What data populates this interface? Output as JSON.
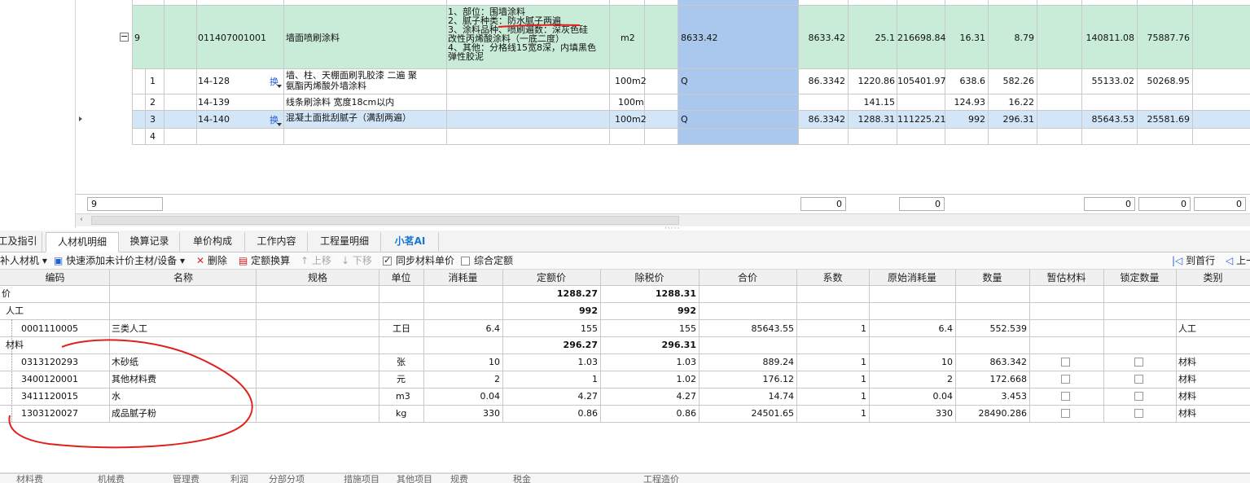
{
  "upper_grid": {
    "row9": {
      "seq": "9",
      "code": "011407001001",
      "name": "墙面喷刷涂料",
      "features": [
        "1、部位：围墙涂料",
        "2、腻子种类：防水腻子两遍",
        "3、涂料品种、喷刷遍数：深灰色硅",
        "改性丙烯酸涂料（一底二度）",
        "4、其他：分格线15宽8深，内填黑色",
        "弹性胶泥"
      ],
      "unit": "m2",
      "qty_expr": "8633.42",
      "qty": "8633.42",
      "unit_price": "25.1",
      "total": "216698.84",
      "labor": "16.31",
      "material": "8.79",
      "c1": "140811.08",
      "c2": "75887.76"
    },
    "sub_rows": [
      {
        "idx": "1",
        "code": "14-128",
        "huan": "换",
        "name_l1": "墙、柱、天棚面刷乳胶漆 二遍 聚",
        "name_l2": "氨酯丙烯酸外墙涂料",
        "unit": "100m2",
        "qty_expr": "Q",
        "qty": "86.3342",
        "unit_price": "1220.86",
        "total": "105401.97",
        "labor": "638.6",
        "material": "582.26",
        "c1": "55133.02",
        "c2": "50268.95"
      },
      {
        "idx": "2",
        "code": "14-139",
        "huan": "",
        "name_l1": "线条刷涂料 宽度18cm以内",
        "name_l2": "",
        "unit": "100m",
        "qty_expr": "",
        "qty": "",
        "unit_price": "141.15",
        "total": "",
        "labor": "124.93",
        "material": "16.22",
        "c1": "",
        "c2": ""
      },
      {
        "idx": "3",
        "code": "14-140",
        "huan": "换",
        "name_l1": "混凝土面批刮腻子（满刮两遍）",
        "name_l2": "",
        "unit": "100m2",
        "qty_expr": "Q",
        "qty": "86.3342",
        "unit_price": "1288.31",
        "total": "111225.21",
        "labor": "992",
        "material": "296.31",
        "c1": "85643.53",
        "c2": "25581.69"
      },
      {
        "idx": "4",
        "code": "",
        "huan": "",
        "name_l1": "",
        "name_l2": "",
        "unit": "",
        "qty_expr": "",
        "qty": "",
        "unit_price": "",
        "total": "",
        "labor": "",
        "material": "",
        "c1": "",
        "c2": ""
      }
    ],
    "footer": {
      "count": "9",
      "z1": "0",
      "z2": "0",
      "z3": "0",
      "z4": "0",
      "z5": "0"
    }
  },
  "tabs": [
    {
      "label": "工及指引"
    },
    {
      "label": "人材机明细"
    },
    {
      "label": "换算记录"
    },
    {
      "label": "单价构成"
    },
    {
      "label": "工作内容"
    },
    {
      "label": "工程量明细"
    },
    {
      "label": "小茗AI"
    }
  ],
  "toolbar": {
    "add_rcj": "补人材机",
    "quick_add": "快速添加未计价主材/设备",
    "delete": "删除",
    "quota_convert": "定额换算",
    "move_up": "上移",
    "move_down": "下移",
    "sync_price": "同步材料单价",
    "combined_quota": "综合定额",
    "to_first": "到首行",
    "prev": "上一"
  },
  "lower_grid": {
    "headers": [
      "编码",
      "名称",
      "规格",
      "单位",
      "消耗量",
      "定额价",
      "除税价",
      "合价",
      "系数",
      "原始消耗量",
      "数量",
      "暂估材料",
      "锁定数量",
      "类别"
    ],
    "rows": [
      {
        "code": "价",
        "name": "",
        "spec": "",
        "unit": "",
        "consume": "",
        "quota_price": "1288.27",
        "tax_ex_price": "1288.31",
        "amount": "",
        "coef": "",
        "orig": "",
        "qty": "",
        "bold": true,
        "type": ""
      },
      {
        "code": "人工",
        "name": "",
        "spec": "",
        "unit": "",
        "consume": "",
        "quota_price": "992",
        "tax_ex_price": "992",
        "amount": "",
        "coef": "",
        "orig": "",
        "qty": "",
        "bold": true,
        "type": ""
      },
      {
        "code": "0001110005",
        "name": "三类人工",
        "spec": "",
        "unit": "工日",
        "consume": "6.4",
        "quota_price": "155",
        "tax_ex_price": "155",
        "amount": "85643.55",
        "coef": "1",
        "orig": "6.4",
        "qty": "552.539",
        "bold": false,
        "type": "人工"
      },
      {
        "code": "材料",
        "name": "",
        "spec": "",
        "unit": "",
        "consume": "",
        "quota_price": "296.27",
        "tax_ex_price": "296.31",
        "amount": "",
        "coef": "",
        "orig": "",
        "qty": "",
        "bold": true,
        "type": ""
      },
      {
        "code": "0313120293",
        "name": "木砂纸",
        "spec": "",
        "unit": "张",
        "consume": "10",
        "quota_price": "1.03",
        "tax_ex_price": "1.03",
        "amount": "889.24",
        "coef": "1",
        "orig": "10",
        "qty": "863.342",
        "bold": false,
        "type": "材料"
      },
      {
        "code": "3400120001",
        "name": "其他材料费",
        "spec": "",
        "unit": "元",
        "consume": "2",
        "quota_price": "1",
        "tax_ex_price": "1.02",
        "amount": "176.12",
        "coef": "1",
        "orig": "2",
        "qty": "172.668",
        "bold": false,
        "type": "材料"
      },
      {
        "code": "3411120015",
        "name": "水",
        "spec": "",
        "unit": "m3",
        "consume": "0.04",
        "quota_price": "4.27",
        "tax_ex_price": "4.27",
        "amount": "14.74",
        "coef": "1",
        "orig": "0.04",
        "qty": "3.453",
        "bold": false,
        "type": "材料"
      },
      {
        "code": "1303120027",
        "name": "成品腻子粉",
        "spec": "",
        "unit": "kg",
        "consume": "330",
        "quota_price": "0.86",
        "tax_ex_price": "0.86",
        "amount": "24501.65",
        "coef": "1",
        "orig": "330",
        "qty": "28490.286",
        "bold": false,
        "type": "材料"
      }
    ]
  },
  "status_bar": {
    "items": [
      "材料费",
      "机械费",
      "管理费",
      "利润",
      "分部分项",
      "措施项目",
      "其他项目",
      "规费",
      "税金",
      "工程造价"
    ]
  },
  "colors": {
    "annotation": "#e0201c",
    "selected_row": "#d3e6f8",
    "list_row": "#c9ecd8",
    "qty_column": "#aac8ee",
    "ai_tab": "#1677d2"
  }
}
